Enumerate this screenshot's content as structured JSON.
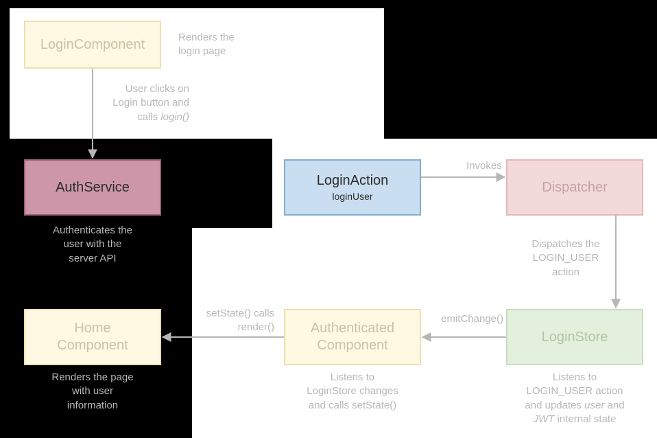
{
  "nodes": {
    "loginComponent": {
      "title": "LoginComponent"
    },
    "loginComponent_note": "Renders the\nlogin page",
    "authService": {
      "title": "AuthService"
    },
    "authService_note": "Authenticates the\nuser with the\nserver API",
    "loginAction": {
      "title": "LoginAction",
      "subtitle": "loginUser"
    },
    "dispatcher": {
      "title": "Dispatcher"
    },
    "loginStore": {
      "title": "LoginStore"
    },
    "loginStore_note_l1": "Listens to",
    "loginStore_note_l2": "LOGIN_USER action",
    "loginStore_note_l3a": "and updates ",
    "loginStore_note_l3b": "user",
    "loginStore_note_l3c": " and",
    "loginStore_note_l4a": "JWT",
    "loginStore_note_l4b": " internal state",
    "authComponent": {
      "title_l1": "Authenticated",
      "title_l2": "Component"
    },
    "authComponent_note": "Listens to\nLoginStore changes\nand calls setState()",
    "homeComponent": {
      "title_l1": "Home",
      "title_l2": "Component"
    },
    "homeComponent_note": "Renders the page\nwith user\ninformation"
  },
  "edges": {
    "login_to_auth_l1": "User clicks on",
    "login_to_auth_l2": "Login button and",
    "login_to_auth_l3a": "calls ",
    "login_to_auth_l3b": "login()",
    "action_to_dispatcher": "Invokes",
    "dispatcher_to_store": "Dispatches the\nLOGIN_USER\naction",
    "store_to_auth": "emitChange()",
    "auth_to_home": "setState() calls\nrender()"
  }
}
